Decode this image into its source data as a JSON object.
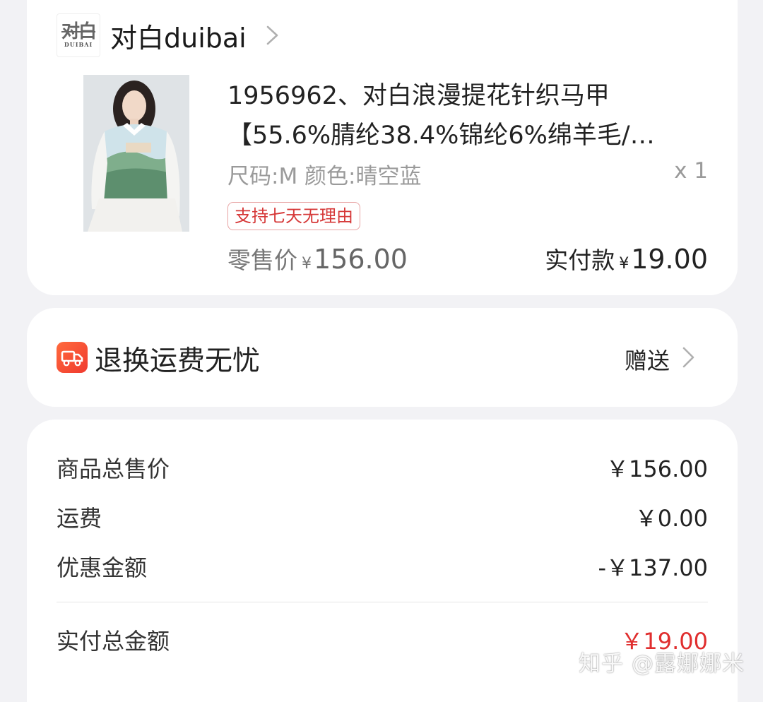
{
  "shop": {
    "logo_main": "对白",
    "logo_sub": "DUIBAI",
    "name": "对白duibai"
  },
  "product": {
    "title_line1": "1956962、对白浪漫提花针织马甲",
    "title_line2": "【55.6%腈纶38.4%锦纶6%绵羊毛/…",
    "spec": "尺码:M 颜色:晴空蓝",
    "qty": "x 1",
    "return_tag": "支持七天无理由",
    "retail_label": "零售价",
    "retail_currency": "¥",
    "retail_value": "156.00",
    "paid_label": "实付款",
    "paid_currency": "¥",
    "paid_value": "19.00"
  },
  "shipping": {
    "icon": "truck-icon",
    "title": "退换运费无忧",
    "value": "赠送"
  },
  "summary": {
    "rows": [
      {
        "label": "商品总售价",
        "value": "￥156.00"
      },
      {
        "label": "运费",
        "value": "￥0.00"
      },
      {
        "label": "优惠金额",
        "value": "-￥137.00"
      }
    ],
    "total_label": "实付总金额",
    "total_value": "￥19.00"
  },
  "colors": {
    "accent_red": "#e02e2e",
    "tag_red": "#d63838",
    "ship_icon": "#f03a2f"
  },
  "watermark": "知乎 @露娜娜米"
}
